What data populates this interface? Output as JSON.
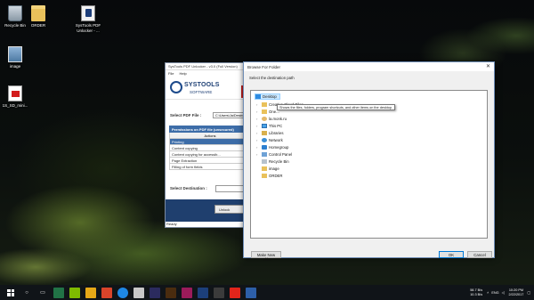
{
  "desktop": {
    "icons": [
      {
        "label": "Recycle Bin"
      },
      {
        "label": "ORDER"
      },
      {
        "label": "SysTools PDF\nUnlocker - ..."
      },
      {
        "label": "image"
      },
      {
        "label": "1S_SD_mini..."
      }
    ]
  },
  "app": {
    "title": "SysTools PDF Unlocker - v3.0 (Full Version)",
    "menu": [
      "File",
      "Help"
    ],
    "logo_main": "SYSTOOLS",
    "logo_sub": "SOFTWARE",
    "select_pdf_label": "Select PDF File :",
    "pdf_path": "C:\\Users\\Ja\\Desktop",
    "permissions_header": "Permissions on PDF file (unsecured)",
    "actions_header": "Actions",
    "permissions": [
      "Printing",
      "Content copying",
      "Content copying for accessib...",
      "Page Extraction",
      "Filling of form fields"
    ],
    "select_destination_label": "Select Destination :",
    "unlock_button": "Unlock",
    "status": "Ready"
  },
  "dialog": {
    "title": "Browse For Folder",
    "close_glyph": "✕",
    "subtitle": "Select the destination path",
    "tree": [
      {
        "label": "Desktop",
        "icon": "desktop-icon"
      },
      {
        "label": "Creative Cloud Files",
        "icon": "folder-icon"
      },
      {
        "label": "One...",
        "icon": "folder-icon"
      },
      {
        "label": "la.monk.ru",
        "icon": "user-folder-icon"
      },
      {
        "label": "This PC",
        "icon": "computer-icon"
      },
      {
        "label": "Libraries",
        "icon": "library-icon"
      },
      {
        "label": "Network",
        "icon": "network-icon"
      },
      {
        "label": "Homegroup",
        "icon": "homegroup-icon"
      },
      {
        "label": "Control Panel",
        "icon": "control-panel-icon"
      },
      {
        "label": "Recycle Bin",
        "icon": "recycle-bin-icon"
      },
      {
        "label": "image",
        "icon": "folder-icon"
      },
      {
        "label": "ORDER",
        "icon": "folder-icon"
      }
    ],
    "tooltip": "Shows the files, folders, program shortcuts, and other items on the desktop.",
    "make_new_folder": "Make New Folder",
    "ok": "OK",
    "cancel": "Cancel"
  },
  "taskbar": {
    "network_up": "58.7 B/s",
    "network_down": "10.3 B/s",
    "language": "ENG",
    "time": "10:20 PM",
    "date": "2/22/2017"
  }
}
